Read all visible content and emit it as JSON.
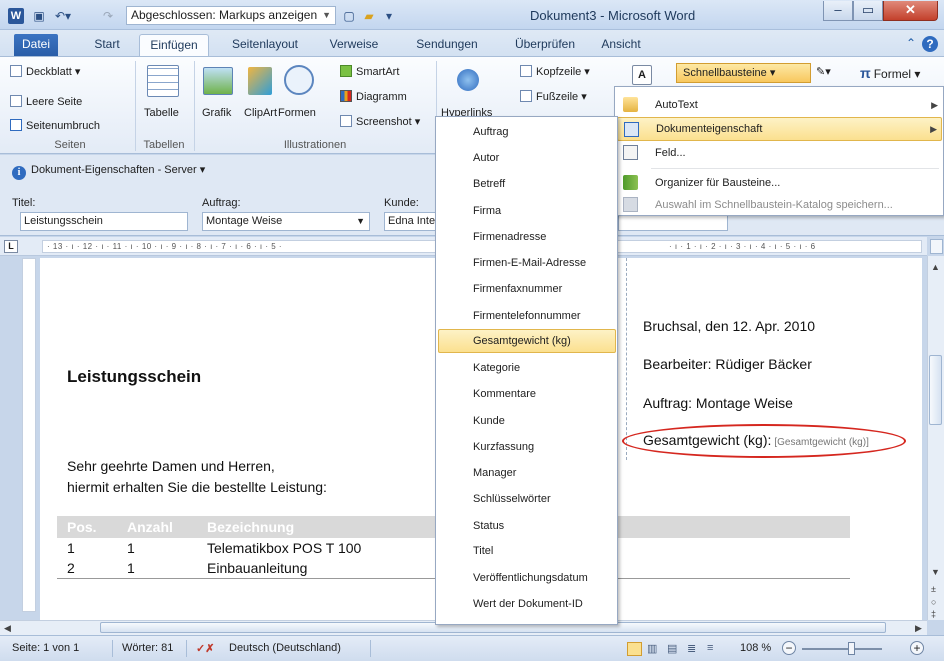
{
  "window": {
    "title": "Dokument3 - Microsoft Word",
    "app_icon": "W",
    "qat_combo_value": "Abgeschlossen: Markups anzeigen"
  },
  "tabs": [
    "Datei",
    "Start",
    "Einfügen",
    "Seitenlayout",
    "Verweise",
    "Sendungen",
    "Überprüfen",
    "Ansicht"
  ],
  "active_tab": "Einfügen",
  "ribbon": {
    "seiten": {
      "deckblatt": "Deckblatt ▾",
      "leere_seite": "Leere Seite",
      "seitenumbruch": "Seitenumbruch",
      "label": "Seiten"
    },
    "tabellen": {
      "tabelle": "Tabelle",
      "label": "Tabellen"
    },
    "illustrationen": {
      "grafik": "Grafik",
      "clipart": "ClipArt",
      "formen": "Formen",
      "smartart": "SmartArt",
      "diagramm": "Diagramm",
      "screenshot": "Screenshot ▾",
      "label": "Illustrationen"
    },
    "hyperlinks": "Hyperlinks",
    "kopfzeile": "Kopfzeile ▾",
    "fusszeile": "Fußzeile ▾",
    "schnellbausteine": "Schnellbausteine ▾",
    "formel": "Formel ▾",
    "formel_symbol": "π"
  },
  "doc_info": {
    "title": "Dokument-Eigenschaften - Server ▾",
    "titel_label": "Titel:",
    "titel_value": "Leistungsschein",
    "auftrag_label": "Auftrag:",
    "auftrag_value": "Montage Weise",
    "kunde_label": "Kunde:",
    "kunde_value": "Edna Inte"
  },
  "ruler": {
    "left_text": "· 13 · ı · 12 · ı · 11 · ı · 10 · ı · 9 · ı · 8 · ı · 7 · ı · 6 · ı · 5 ·",
    "right_text": "· ı · 1 · ı · 2 · ı · 3 · ı · 4 · ı · 5 · ı · 6"
  },
  "document": {
    "heading": "Leistungsschein",
    "greeting": "Sehr geehrte Damen und Herren,",
    "body": "hiermit erhalten Sie die bestellte Leistung:",
    "date_line": "Bruchsal, den 12. Apr. 2010",
    "bearbeiter": "Bearbeiter: Rüdiger Bäcker",
    "auftrag": "Auftrag: Montage Weise",
    "gesamtgewicht_label": "Gesamtgewicht (kg):",
    "gesamtgewicht_placeholder": "[Gesamtgewicht (kg)]",
    "table": {
      "headers": [
        "Pos.",
        "Anzahl",
        "Bezeichnung"
      ],
      "rows": [
        [
          "1",
          "1",
          "Telematikbox POS T 100"
        ],
        [
          "2",
          "1",
          "Einbauanleitung"
        ]
      ]
    }
  },
  "submenu_items": [
    "Auftrag",
    "Autor",
    "Betreff",
    "Firma",
    "Firmenadresse",
    "Firmen-E-Mail-Adresse",
    "Firmenfaxnummer",
    "Firmentelefonnummer",
    "Gesamtgewicht (kg)",
    "Kategorie",
    "Kommentare",
    "Kunde",
    "Kurzfassung",
    "Manager",
    "Schlüsselwörter",
    "Status",
    "Titel",
    "Veröffentlichungsdatum",
    "Wert der Dokument-ID"
  ],
  "submenu_highlighted": "Gesamtgewicht (kg)",
  "quickparts_menu": {
    "autotext": "AutoText",
    "dokumenteigenschaft": "Dokumenteigenschaft",
    "feld": "Feld...",
    "organizer": "Organizer für Bausteine...",
    "auswahl_speichern": "Auswahl im Schnellbaustein-Katalog speichern..."
  },
  "statusbar": {
    "seite": "Seite: 1 von 1",
    "woerter": "Wörter: 81",
    "sprache": "Deutsch (Deutschland)",
    "zoom": "108 %"
  },
  "colors": {
    "accent": "#2b579a",
    "highlight": "#fbe08f",
    "annotation_ellipse": "#d5271f"
  }
}
